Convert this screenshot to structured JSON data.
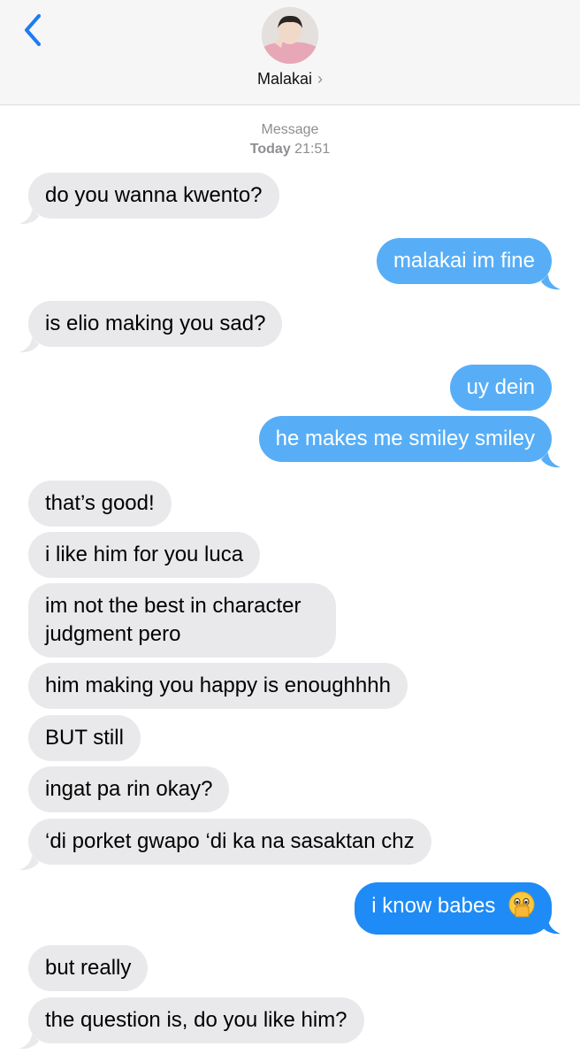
{
  "header": {
    "contact_name": "Malakai",
    "chevron": "›"
  },
  "thread": {
    "service_label": "Message",
    "day_label": "Today",
    "time_label": "21:51"
  },
  "messages": [
    {
      "text": "do you wanna kwento?",
      "from": "them"
    },
    {
      "text": "malakai im fine",
      "from": "me",
      "delivery": "sms"
    },
    {
      "text": "is elio making you sad?",
      "from": "them"
    },
    {
      "text": "uy dein",
      "from": "me",
      "delivery": "sms"
    },
    {
      "text": "he makes me smiley smiley",
      "from": "me",
      "delivery": "sms"
    },
    {
      "text": "that’s good!",
      "from": "them"
    },
    {
      "text": "i like him for you luca",
      "from": "them"
    },
    {
      "text": "im not the best in character judgment pero",
      "from": "them"
    },
    {
      "text": "him making you happy is enoughhhh",
      "from": "them"
    },
    {
      "text": "BUT still",
      "from": "them"
    },
    {
      "text": "ingat pa rin okay?",
      "from": "them"
    },
    {
      "text": "‘di porket gwapo ‘di ka na sasaktan chz",
      "from": "them"
    },
    {
      "text": "i know babes",
      "from": "me",
      "delivery": "imessage",
      "emoji": "face-with-open-eyes-and-hand-over-mouth"
    },
    {
      "text": "but really",
      "from": "them"
    },
    {
      "text": "the question is, do you like him?",
      "from": "them"
    }
  ],
  "colors": {
    "received_bubble": "#e9e9eb",
    "sent_imessage": "#1e8bf6",
    "sent_sms_light": "#57aef7",
    "accent": "#1e7cf2",
    "meta_gray": "#8e8e93"
  }
}
